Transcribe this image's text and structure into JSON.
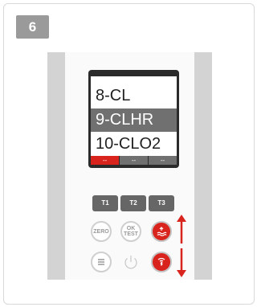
{
  "step": {
    "number": "6"
  },
  "screen": {
    "menu": [
      {
        "label": "8-CL",
        "selected": false
      },
      {
        "label": "9-CLHR",
        "selected": true
      },
      {
        "label": "10-CLO2",
        "selected": false
      }
    ],
    "softkeys": [
      "--",
      "--",
      "--"
    ]
  },
  "buttons": {
    "t1": "T1",
    "t2": "T2",
    "t3": "T3",
    "zero": "ZERO",
    "ok_test_line1": "OK",
    "ok_test_line2": "TEST"
  },
  "colors": {
    "accent_red": "#d9231d",
    "button_gray": "#666666",
    "screen_select": "#707070"
  },
  "icons": [
    "up-arrow-icon",
    "down-arrow-icon",
    "menu-icon",
    "power-icon",
    "water-level-icon",
    "bluetooth-icon"
  ]
}
